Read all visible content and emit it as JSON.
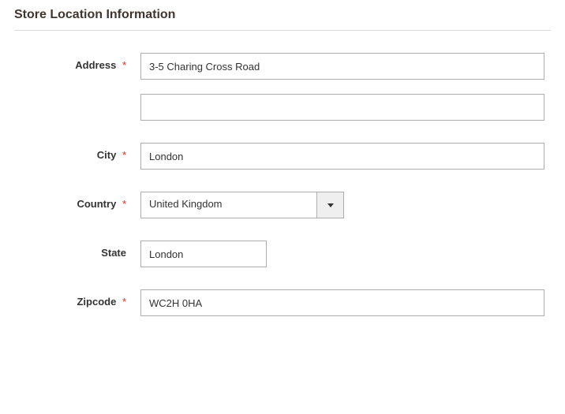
{
  "section": {
    "title": "Store Location Information"
  },
  "fields": {
    "address": {
      "label": "Address",
      "value": "3-5 Charing Cross Road",
      "value2": ""
    },
    "city": {
      "label": "City",
      "value": "London"
    },
    "country": {
      "label": "Country",
      "selected": "United Kingdom"
    },
    "state": {
      "label": "State",
      "value": "London"
    },
    "zipcode": {
      "label": "Zipcode",
      "value": "WC2H 0HA"
    }
  }
}
